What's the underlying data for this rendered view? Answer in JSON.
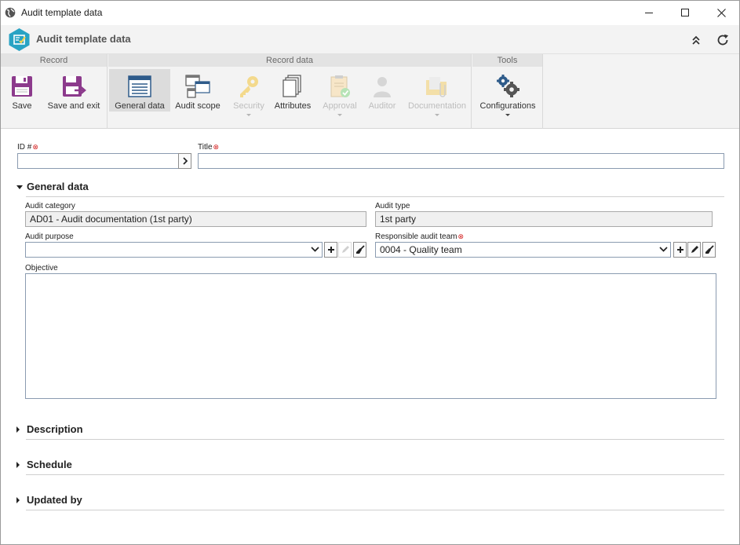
{
  "window": {
    "title": "Audit template data",
    "controls": [
      "minimize",
      "maximize",
      "close"
    ]
  },
  "header": {
    "title": "Audit template data"
  },
  "ribbon": {
    "groups": [
      {
        "title": "Record"
      },
      {
        "title": "Record data"
      },
      {
        "title": "Tools"
      }
    ],
    "buttons": {
      "save": "Save",
      "save_exit": "Save and exit",
      "general_data": "General data",
      "audit_scope": "Audit scope",
      "security": "Security",
      "attributes": "Attributes",
      "approval": "Approval",
      "auditor": "Auditor",
      "documentation": "Documentation",
      "configurations": "Configurations"
    }
  },
  "form": {
    "id_label": "ID #",
    "id_value": "",
    "title_label": "Title",
    "title_value": "",
    "general_section": "General data",
    "audit_category_label": "Audit category",
    "audit_category_value": "AD01 - Audit documentation (1st party)",
    "audit_type_label": "Audit type",
    "audit_type_value": "1st party",
    "audit_purpose_label": "Audit purpose",
    "audit_purpose_value": "",
    "responsible_team_label": "Responsible audit team",
    "responsible_team_value": "0004 - Quality team",
    "objective_label": "Objective",
    "objective_value": "",
    "collapsed_sections": [
      "Description",
      "Schedule",
      "Updated by"
    ]
  },
  "colors": {
    "required_marker": "#d31f1f",
    "logo": "#29a3c4",
    "save_icon": "#8c3a8c"
  }
}
